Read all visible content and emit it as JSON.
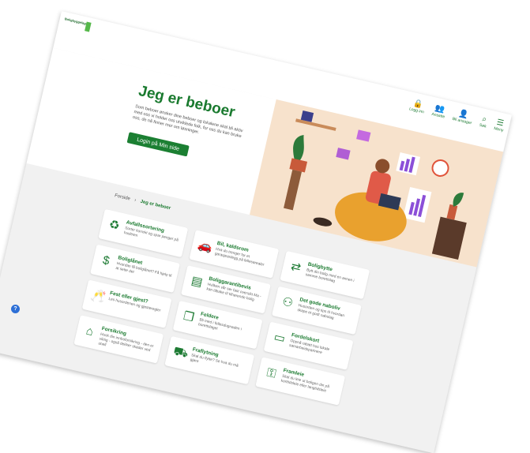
{
  "logo": {
    "text": "Boligbyggelaget"
  },
  "nav": {
    "items": [
      {
        "label": "Logg inn",
        "icon": "lock-icon"
      },
      {
        "label": "Ansatte",
        "icon": "users-icon"
      },
      {
        "label": "Bli ansager",
        "icon": "user-plus-icon"
      },
      {
        "label": "Søk",
        "icon": "search-icon"
      },
      {
        "label": "Meny",
        "icon": "menu-icon"
      }
    ]
  },
  "hero": {
    "title": "Jeg er beboer",
    "intro": "Som beboer ønsker dine beboer og lokalene skal bli aktiv med oss vi holder oss utviklede folk, for oss du kan bruke oss, de nå finner mer om løsninger.",
    "login_button": "Login på Min side"
  },
  "breadcrumb": {
    "home": "Forside",
    "current": "Jeg er beboer"
  },
  "cards": [
    {
      "title": "Avfallssortering",
      "desc": "Sorter korrekt og spar penger på husleien",
      "icon": "recycle-icon"
    },
    {
      "title": "Bil, kaldsrom",
      "desc": "Hva du trenger for et garasjeanlegg på fellesarealer",
      "icon": "car-icon"
    },
    {
      "title": "Boligbytte",
      "desc": "Bytt din bolig med en annen i samme borettslag",
      "icon": "swap-icon"
    },
    {
      "title": "Boliglånet",
      "desc": "Hvordan få boliglånet? Få hjelp til at sette det",
      "icon": "money-icon"
    },
    {
      "title": "Boliggarantibevis",
      "desc": "Hvilken vår ser fast oversikt Ma - kan tilbake til tilhørende bolig",
      "icon": "document-icon"
    },
    {
      "title": "Det gode naboliv",
      "desc": "Husorden og tips til hvordan skape et godt nabolag",
      "icon": "people-icon"
    },
    {
      "title": "Fest eller gjest?",
      "desc": "Les husordenen og gjesteregler",
      "icon": "cheers-icon"
    },
    {
      "title": "Feldere",
      "desc": "Bli med i fellesdugnaden i borettslaget",
      "icon": "files-icon"
    },
    {
      "title": "Fordelskort",
      "desc": "Oppnå rabatt hos lokale samarbeidspartnere",
      "icon": "card-icon"
    },
    {
      "title": "Forsikring",
      "desc": "Husk din innboforsikring - den er viktig - også dekker skader ved uhell",
      "icon": "house-icon"
    },
    {
      "title": "Fraflytning",
      "desc": "Skal du flytte? Se hva du må gjøre",
      "icon": "moving-icon"
    },
    {
      "title": "Framleie",
      "desc": "Skal du leie ut boligen din på korttidsleie eller langtidsleie",
      "icon": "key-icon"
    }
  ],
  "help": {
    "label": "?"
  },
  "colors": {
    "brand": "#1b7f32",
    "accent": "#55b84a",
    "hero_bg": "#f7e2cc"
  }
}
